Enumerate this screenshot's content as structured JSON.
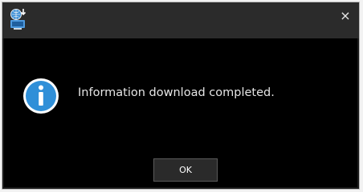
{
  "dialog": {
    "message": "Information download completed.",
    "close_glyph": "×",
    "ok_label": "OK",
    "icons": {
      "app": "network-download-icon",
      "info": "info-icon",
      "close": "close-icon"
    },
    "colors": {
      "title_bar": "#2b2b2b",
      "body": "#000000",
      "info_blue": "#2f8fd8",
      "text": "#e6e6e6"
    }
  }
}
